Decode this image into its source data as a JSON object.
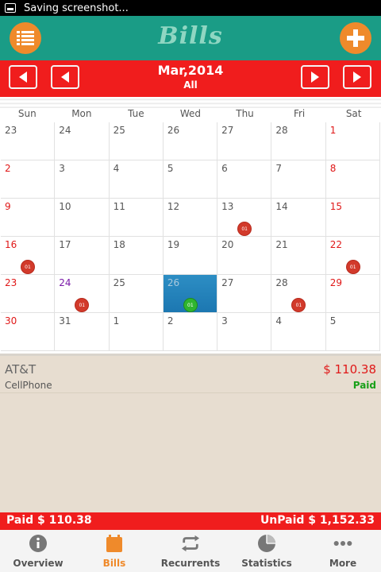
{
  "status_bar": {
    "text": "Saving screenshot..."
  },
  "app_bar": {
    "title": "Bills",
    "left_icon": "list-icon",
    "right_icon": "plus-icon"
  },
  "month_bar": {
    "title": "Mar,2014",
    "filter": "All"
  },
  "calendar": {
    "weekdays": [
      "Sun",
      "Mon",
      "Tue",
      "Wed",
      "Thu",
      "Fri",
      "Sat"
    ],
    "cells": [
      {
        "day": "23",
        "color": "gray"
      },
      {
        "day": "24",
        "color": "gray"
      },
      {
        "day": "25",
        "color": "gray"
      },
      {
        "day": "26",
        "color": "gray"
      },
      {
        "day": "27",
        "color": "gray"
      },
      {
        "day": "28",
        "color": "gray"
      },
      {
        "day": "1",
        "color": "red"
      },
      {
        "day": "2",
        "color": "red"
      },
      {
        "day": "3",
        "color": "gray"
      },
      {
        "day": "4",
        "color": "gray"
      },
      {
        "day": "5",
        "color": "gray"
      },
      {
        "day": "6",
        "color": "gray"
      },
      {
        "day": "7",
        "color": "gray"
      },
      {
        "day": "8",
        "color": "red"
      },
      {
        "day": "9",
        "color": "red"
      },
      {
        "day": "10",
        "color": "gray"
      },
      {
        "day": "11",
        "color": "gray"
      },
      {
        "day": "12",
        "color": "gray"
      },
      {
        "day": "13",
        "color": "gray",
        "badge": "01"
      },
      {
        "day": "14",
        "color": "gray"
      },
      {
        "day": "15",
        "color": "red"
      },
      {
        "day": "16",
        "color": "red",
        "badge": "01"
      },
      {
        "day": "17",
        "color": "gray"
      },
      {
        "day": "18",
        "color": "gray"
      },
      {
        "day": "19",
        "color": "gray"
      },
      {
        "day": "20",
        "color": "gray"
      },
      {
        "day": "21",
        "color": "gray"
      },
      {
        "day": "22",
        "color": "red",
        "badge": "01"
      },
      {
        "day": "23",
        "color": "red"
      },
      {
        "day": "24",
        "color": "purple",
        "badge": "01"
      },
      {
        "day": "25",
        "color": "gray"
      },
      {
        "day": "26",
        "color": "gray",
        "today": true,
        "badge": "01",
        "badge_color": "green"
      },
      {
        "day": "27",
        "color": "gray"
      },
      {
        "day": "28",
        "color": "gray",
        "badge": "01"
      },
      {
        "day": "29",
        "color": "red"
      },
      {
        "day": "30",
        "color": "red"
      },
      {
        "day": "31",
        "color": "gray"
      },
      {
        "day": "1",
        "color": "gray"
      },
      {
        "day": "2",
        "color": "gray"
      },
      {
        "day": "3",
        "color": "gray"
      },
      {
        "day": "4",
        "color": "gray"
      },
      {
        "day": "5",
        "color": "gray"
      }
    ]
  },
  "bills": [
    {
      "name": "AT&T",
      "amount": "$ 110.38",
      "category": "CellPhone",
      "status": "Paid"
    }
  ],
  "totals": {
    "paid": "Paid $ 110.38",
    "unpaid": "UnPaid $ 1,152.33"
  },
  "tabs": [
    {
      "label": "Overview",
      "icon": "info-icon",
      "active": false
    },
    {
      "label": "Bills",
      "icon": "calendar-icon",
      "active": true
    },
    {
      "label": "Recurrents",
      "icon": "repeat-icon",
      "active": false
    },
    {
      "label": "Statistics",
      "icon": "pie-chart-icon",
      "active": false
    },
    {
      "label": "More",
      "icon": "more-dots-icon",
      "active": false
    }
  ],
  "colors": {
    "appbar": "#1a9c86",
    "accent": "#ef8a2b",
    "month_bar": "#f01d1d",
    "today": "#1c77b1",
    "paid": "#19a019"
  }
}
